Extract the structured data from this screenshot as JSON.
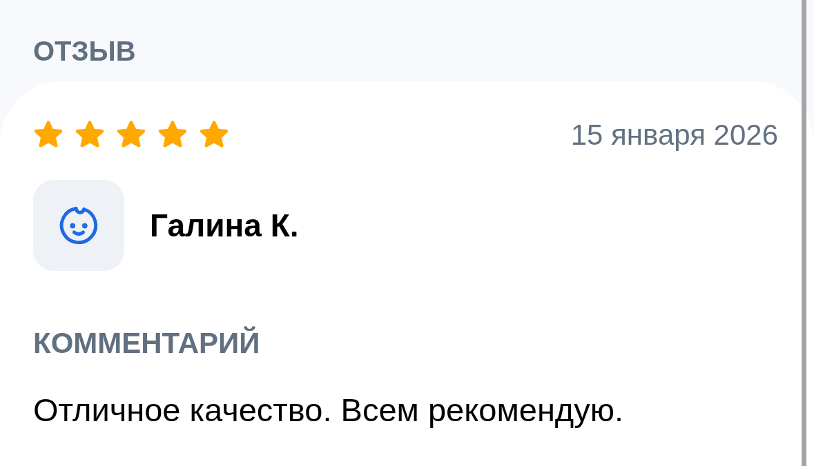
{
  "section_title": "ОТЗЫВ",
  "review": {
    "stars": 5,
    "date": "15 января 2026",
    "author": {
      "name": "Галина К."
    },
    "comment_label": "КОММЕНТАРИЙ",
    "comment": "Отличное качество. Всем рекомендую."
  }
}
